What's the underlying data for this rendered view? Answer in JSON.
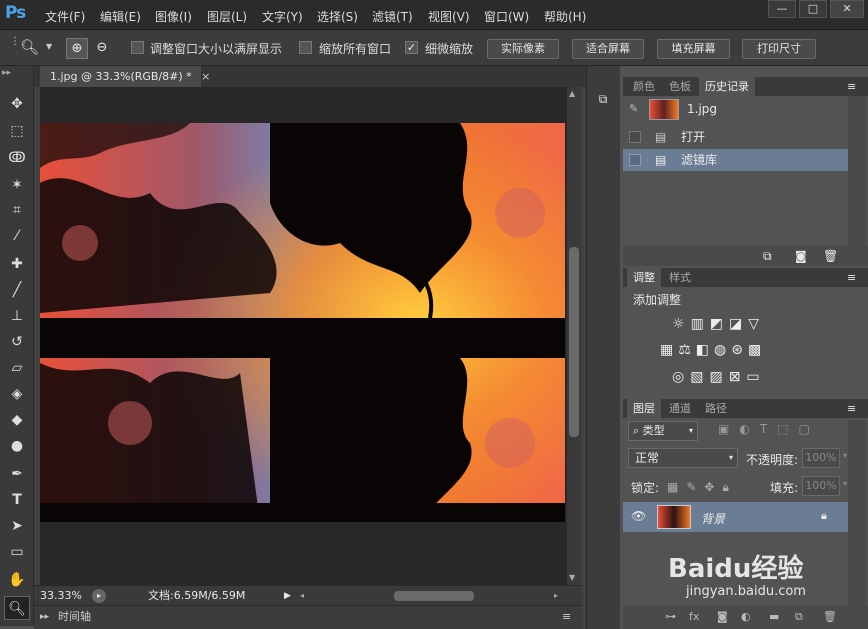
{
  "app": {
    "logo": "Ps"
  },
  "menu": [
    "文件(F)",
    "编辑(E)",
    "图像(I)",
    "图层(L)",
    "文字(Y)",
    "选择(S)",
    "滤镜(T)",
    "视图(V)",
    "窗口(W)",
    "帮助(H)"
  ],
  "window_controls": {
    "minimize": "—",
    "maximize": "□",
    "close": "✕"
  },
  "options": {
    "resize_windows": "调整窗口大小以满屏显示",
    "zoom_all_windows": "缩放所有窗口",
    "scrubby_zoom": "细微缩放",
    "scrubby_checked": true,
    "actual_pixels": "实际像素",
    "fit_screen": "适合屏幕",
    "fill_screen": "填充屏幕",
    "print_size": "打印尺寸"
  },
  "document": {
    "tab_title": "1.jpg @ 33.3%(RGB/8#) *",
    "close": "×"
  },
  "status": {
    "zoom": "33.33%",
    "doc_info": "文档:6.59M/6.59M"
  },
  "timeline": {
    "label": "时间轴"
  },
  "top_panel": {
    "tabs": [
      "颜色",
      "色板",
      "历史记录"
    ],
    "active_tab": "历史记录",
    "snapshot": "1.jpg",
    "history": [
      "打开",
      "滤镜库"
    ]
  },
  "adjust_panel": {
    "tabs": [
      "调整",
      "样式"
    ],
    "heading": "添加调整"
  },
  "layers_panel": {
    "tabs": [
      "图层",
      "通道",
      "路径"
    ],
    "filter_kind": "类型",
    "blend_mode": "正常",
    "opacity_label": "不透明度:",
    "opacity_value": "100%",
    "lock_label": "锁定:",
    "fill_label": "填充:",
    "fill_value": "100%",
    "layer_name": "背景"
  },
  "watermark": {
    "brand": "Baidu经验",
    "url": "jingyan.baidu.com"
  }
}
